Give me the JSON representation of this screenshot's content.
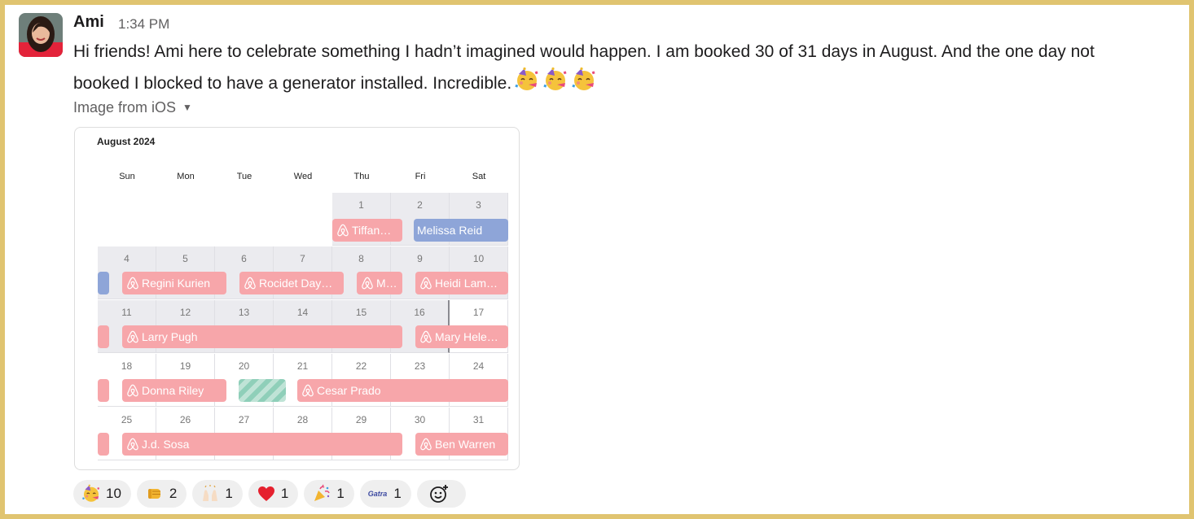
{
  "message": {
    "author": "Ami",
    "time": "1:34 PM",
    "line1": "Hi friends!  Ami here to celebrate something I hadn’t imagined would happen.  I am booked 30 of 31 days in August.  And the one day not",
    "line2": "booked I blocked to have a generator installed.  Incredible.",
    "inline_emojis": [
      "partying-face",
      "partying-face",
      "partying-face"
    ]
  },
  "attachment": {
    "label": "Image from iOS",
    "calendar": {
      "month_label": "August 2024",
      "weekdays": [
        "Sun",
        "Mon",
        "Tue",
        "Wed",
        "Thu",
        "Fri",
        "Sat"
      ],
      "weeks": [
        [
          "",
          "",
          "",
          "",
          "1",
          "2",
          "3"
        ],
        [
          "4",
          "5",
          "6",
          "7",
          "8",
          "9",
          "10"
        ],
        [
          "11",
          "12",
          "13",
          "14",
          "15",
          "16",
          "17"
        ],
        [
          "18",
          "19",
          "20",
          "21",
          "22",
          "23",
          "24"
        ],
        [
          "25",
          "26",
          "27",
          "28",
          "29",
          "30",
          "31"
        ]
      ],
      "bookings": [
        "Tiffan…",
        "Melissa Reid",
        "Regini Kurien",
        "Rocidet Day…",
        "M…",
        "Heidi Lam…",
        "Larry Pugh",
        "Mary Hele…",
        "Donna Riley",
        "Cesar Prado",
        "J.d. Sosa",
        "Ben Warren"
      ],
      "colors": {
        "airbnb_booking": "#f7a6aa",
        "other_booking": "#8ea5d8",
        "blocked_day": "#8fcfb9",
        "booked_cell": "#ebebef",
        "open_cell": "#ffffff"
      }
    }
  },
  "reactions": [
    {
      "emoji": "partying-face",
      "count": "10"
    },
    {
      "emoji": "fist-bump",
      "count": "2"
    },
    {
      "emoji": "raised-hands",
      "count": "1"
    },
    {
      "emoji": "red-heart",
      "count": "1"
    },
    {
      "emoji": "party-popper",
      "count": "1"
    },
    {
      "emoji": "gatra-custom",
      "text": "Gatra",
      "count": "1"
    }
  ],
  "add_reaction_icon": "add-emoji-icon"
}
